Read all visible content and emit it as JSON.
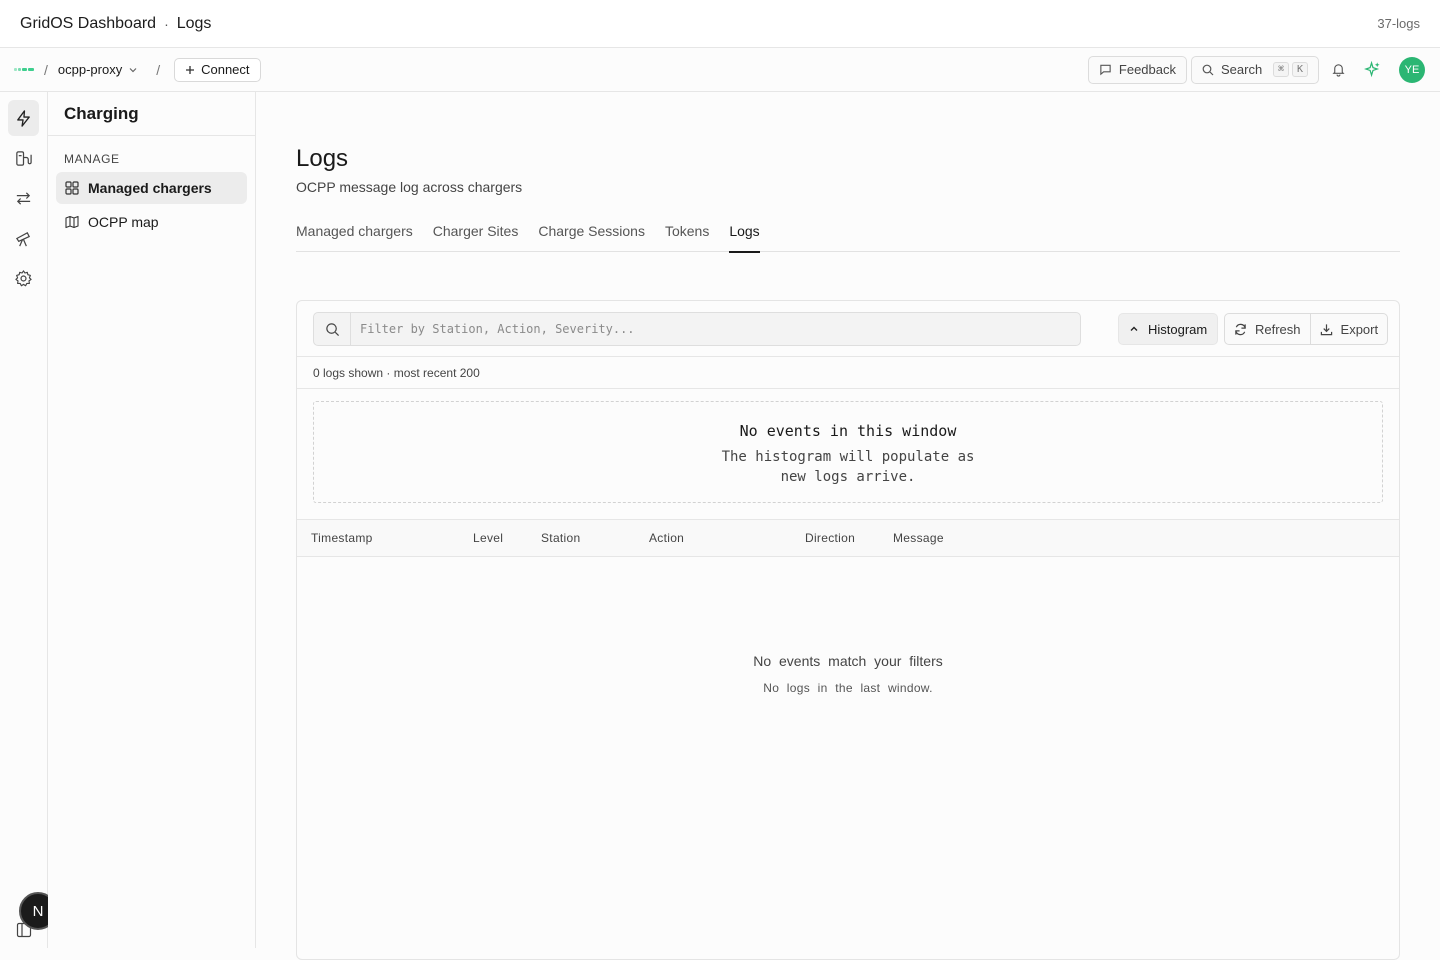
{
  "window": {
    "app_title": "GridOS Dashboard",
    "separator": "·",
    "page": "Logs",
    "right_label": "37-logs"
  },
  "topbar": {
    "slash": "/",
    "project": "ocpp-proxy",
    "connect_label": "Connect",
    "feedback_label": "Feedback",
    "search_label": "Search",
    "shortcut_keys": [
      "⌘",
      "K"
    ],
    "avatar_initials": "YE",
    "brand_color": "#3ecf8e"
  },
  "rail": {
    "items": [
      "lightning-icon",
      "charger-plug-icon",
      "transfer-arrows-icon",
      "telescope-icon",
      "settings-gear-icon"
    ],
    "badge": "N"
  },
  "sidebar": {
    "title": "Charging",
    "section": "MANAGE",
    "items": [
      {
        "label": "Managed chargers",
        "icon": "grid-icon",
        "active": true
      },
      {
        "label": "OCPP map",
        "icon": "map-icon",
        "active": false
      }
    ]
  },
  "main": {
    "title": "Logs",
    "subtitle": "OCPP message log across chargers",
    "tabs": [
      {
        "label": "Managed chargers",
        "active": false
      },
      {
        "label": "Charger Sites",
        "active": false
      },
      {
        "label": "Charge Sessions",
        "active": false
      },
      {
        "label": "Tokens",
        "active": false
      },
      {
        "label": "Logs",
        "active": true
      }
    ],
    "filter_placeholder": "Filter by Station, Action, Severity...",
    "filter_value": "",
    "histogram_label": "Histogram",
    "refresh_label": "Refresh",
    "export_label": "Export",
    "meta": "0 logs shown · most recent 200",
    "histogram_empty": {
      "title": "No events in this window",
      "body": "The histogram will populate as new logs arrive."
    },
    "columns": [
      "Timestamp",
      "Level",
      "Station",
      "Action",
      "Direction",
      "Message"
    ],
    "empty_state": {
      "title": "No events match your filters",
      "body": "No logs in the last window."
    }
  }
}
